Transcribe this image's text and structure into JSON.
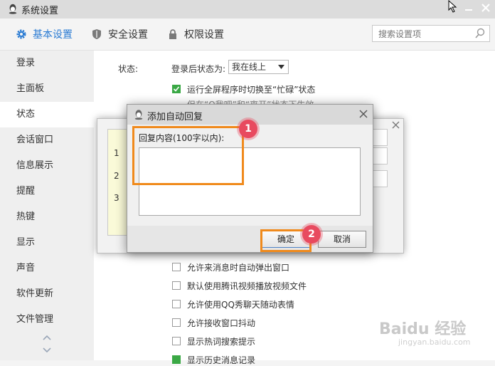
{
  "window": {
    "title": "系统设置"
  },
  "tabs": [
    {
      "label": "基本设置",
      "icon": "gear-icon",
      "active": true
    },
    {
      "label": "安全设置",
      "icon": "shield-icon",
      "active": false
    },
    {
      "label": "权限设置",
      "icon": "lock-icon",
      "active": false
    }
  ],
  "search": {
    "placeholder": "搜索设置项"
  },
  "sidebar": {
    "items": [
      {
        "label": "登录"
      },
      {
        "label": "主面板"
      },
      {
        "label": "状态"
      },
      {
        "label": "会话窗口"
      },
      {
        "label": "信息展示"
      },
      {
        "label": "提醒"
      },
      {
        "label": "热键"
      },
      {
        "label": "显示"
      },
      {
        "label": "声音"
      },
      {
        "label": "软件更新"
      },
      {
        "label": "文件管理"
      }
    ],
    "active_index": 2
  },
  "status_section": {
    "label": "状态:",
    "login_label": "登录后状态为:",
    "login_value": "我在线上",
    "fullscreen_option": "运行全屏程序时切换至“忙碌”状态",
    "partial_hint": "但在“Q我吧”和“离开”状态下生效"
  },
  "bg_dialog": {
    "numbers": [
      "1",
      "2",
      "3"
    ]
  },
  "options": [
    {
      "label": "允许来消息时自动弹出窗口",
      "checked": false
    },
    {
      "label": "默认使用腾讯视频播放视频文件",
      "checked": false
    },
    {
      "label": "允许使用QQ秀聊天随动表情",
      "checked": false
    },
    {
      "label": "允许接收窗口抖动",
      "checked": false
    },
    {
      "label": "显示热词搜索提示",
      "checked": false
    },
    {
      "label": "显示历史消息记录",
      "checked": true
    }
  ],
  "dialog": {
    "title": "添加自动回复",
    "content_label": "回复内容(100字以内):",
    "ok_label": "确定",
    "cancel_label": "取消"
  },
  "markers": [
    "1",
    "2"
  ],
  "watermark": {
    "text": "Baidu 经验",
    "sub": "jingyan.baidu.com"
  },
  "colors": {
    "accent": "#2a7bd3",
    "highlight": "#f08a1c",
    "marker": "#e84a5f",
    "check": "#3aa845"
  }
}
